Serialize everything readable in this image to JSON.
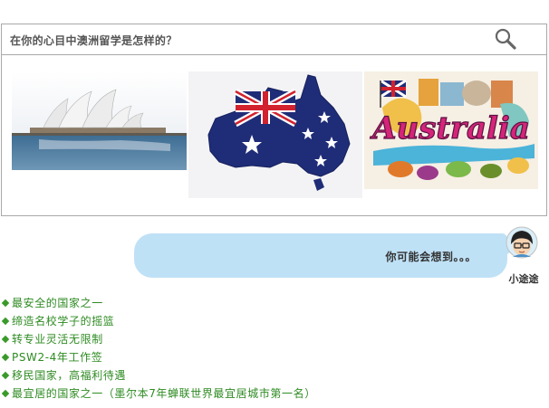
{
  "search": {
    "question": "在你的心目中澳洲留学是怎样的？",
    "search_icon": "magnifier-icon"
  },
  "images": [
    {
      "name": "sydney-opera-house-image"
    },
    {
      "name": "australia-flag-map-image"
    },
    {
      "name": "australia-doodle-lettering-image",
      "lettering": "Australia"
    }
  ],
  "chat": {
    "message": "你可能会想到。。。",
    "avatar_name": "小途途",
    "bubble_color": "#bfe1f6"
  },
  "bullets": {
    "color": "#2e8b22",
    "items": [
      "最安全的国家之一",
      "缔造名校学子的摇篮",
      "转专业灵活无限制",
      "PSW2-4年工作签",
      "移民国家，高福利待遇",
      "最宜居的国家之一（墨尔本7年蝉联世界最宜居城市第一名）"
    ]
  }
}
